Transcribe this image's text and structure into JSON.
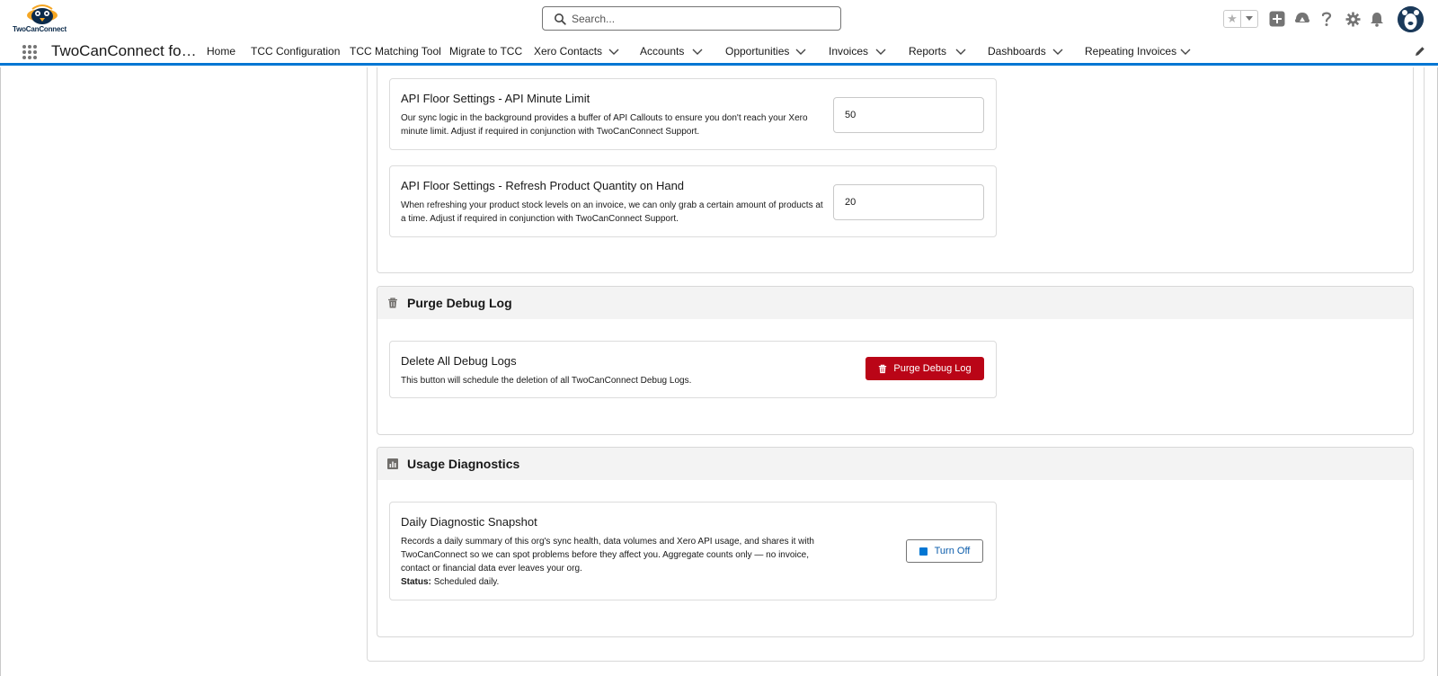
{
  "header": {
    "logo_text": "TwoCanConnect",
    "search_placeholder": "Search..."
  },
  "nav": {
    "app_name": "TwoCanConnect fo…",
    "items": [
      {
        "label": "Home",
        "has_menu": false
      },
      {
        "label": "TCC Configuration",
        "has_menu": false
      },
      {
        "label": "TCC Matching Tool",
        "has_menu": false
      },
      {
        "label": "Migrate to TCC",
        "has_menu": false
      },
      {
        "label": "Xero Contacts",
        "has_menu": true
      },
      {
        "label": "Accounts",
        "has_menu": true
      },
      {
        "label": "Opportunities",
        "has_menu": true
      },
      {
        "label": "Invoices",
        "has_menu": true
      },
      {
        "label": "Reports",
        "has_menu": true
      },
      {
        "label": "Dashboards",
        "has_menu": true
      },
      {
        "label": "Repeating Invoices",
        "has_menu": true
      }
    ]
  },
  "api_settings": {
    "minute_limit": {
      "title": "API Floor Settings - API Minute Limit",
      "description": "Our sync logic in the background provides a buffer of API Callouts to ensure you don't reach your Xero minute limit. Adjust if required in conjunction with TwoCanConnect Support.",
      "value": "50"
    },
    "refresh_qoh": {
      "title": "API Floor Settings - Refresh Product Quantity on Hand",
      "description": "When refreshing your product stock levels on an invoice, we can only grab a certain amount of products at a time. Adjust if required in conjunction with TwoCanConnect Support.",
      "value": "20"
    }
  },
  "purge_section": {
    "title": "Purge Debug Log",
    "icon": "trash-icon",
    "card_title": "Delete All Debug Logs",
    "card_description": "This button will schedule the deletion of all TwoCanConnect Debug Logs.",
    "button_label": "Purge Debug Log",
    "button_color": "#ba0517"
  },
  "usage_section": {
    "title": "Usage Diagnostics",
    "icon": "chart-icon",
    "card_title": "Daily Diagnostic Snapshot",
    "card_description": "Records a daily summary of this org's sync health, data volumes and Xero API usage, and shares it with TwoCanConnect so we can spot problems before they affect you. Aggregate counts only — no invoice, contact or financial data ever leaves your org.",
    "status_label": "Status:",
    "status_value": "Scheduled daily.",
    "button_label": "Turn Off"
  },
  "colors": {
    "brand_blue": "#0176d3",
    "link_blue": "#0b5cab",
    "section_header_bg": "#f3f3f3"
  }
}
